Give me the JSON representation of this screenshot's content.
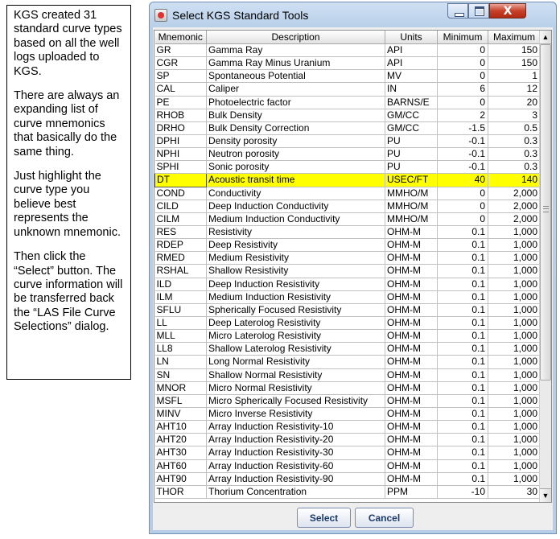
{
  "annotation": {
    "paragraphs": [
      "KGS created 31 standard curve types based on all the well logs uploaded to KGS.",
      "There are always an expanding list of curve mnemonics that basically do the same thing.",
      "Just highlight the curve type  you believe best represents the unknown mnemonic.",
      "Then click the “Select” button. The curve information will be transferred back the “LAS File Curve Selections” dialog."
    ]
  },
  "window": {
    "title": "Select KGS Standard Tools",
    "close_glyph": "X"
  },
  "table": {
    "columns": [
      "Mnemonic",
      "Description",
      "Units",
      "Minimum",
      "Maximum"
    ],
    "selected_row": 10,
    "rows": [
      [
        "GR",
        "Gamma Ray",
        "API",
        "0",
        "150"
      ],
      [
        "CGR",
        "Gamma Ray Minus Uranium",
        "API",
        "0",
        "150"
      ],
      [
        "SP",
        "Spontaneous Potential",
        "MV",
        "0",
        "1"
      ],
      [
        "CAL",
        "Caliper",
        "IN",
        "6",
        "12"
      ],
      [
        "PE",
        "Photoelectric factor",
        "BARNS/E",
        "0",
        "20"
      ],
      [
        "RHOB",
        "Bulk Density",
        "GM/CC",
        "2",
        "3"
      ],
      [
        "DRHO",
        "Bulk Density Correction",
        "GM/CC",
        "-1.5",
        "0.5"
      ],
      [
        "DPHI",
        "Density porosity",
        "PU",
        "-0.1",
        "0.3"
      ],
      [
        "NPHI",
        "Neutron porosity",
        "PU",
        "-0.1",
        "0.3"
      ],
      [
        "SPHI",
        "Sonic porosity",
        "PU",
        "-0.1",
        "0.3"
      ],
      [
        "DT",
        "Acoustic transit time",
        "USEC/FT",
        "40",
        "140"
      ],
      [
        "COND",
        "Conductivity",
        "MMHO/M",
        "0",
        "2,000"
      ],
      [
        "CILD",
        "Deep Induction Conductivity",
        "MMHO/M",
        "0",
        "2,000"
      ],
      [
        "CILM",
        "Medium Induction Conductivity",
        "MMHO/M",
        "0",
        "2,000"
      ],
      [
        "RES",
        "Resistivity",
        "OHM-M",
        "0.1",
        "1,000"
      ],
      [
        "RDEP",
        "Deep Resistivity",
        "OHM-M",
        "0.1",
        "1,000"
      ],
      [
        "RMED",
        "Medium Resistivity",
        "OHM-M",
        "0.1",
        "1,000"
      ],
      [
        "RSHAL",
        "Shallow Resistivity",
        "OHM-M",
        "0.1",
        "1,000"
      ],
      [
        "ILD",
        "Deep Induction Resistivity",
        "OHM-M",
        "0.1",
        "1,000"
      ],
      [
        "ILM",
        "Medium Induction Resistivity",
        "OHM-M",
        "0.1",
        "1,000"
      ],
      [
        "SFLU",
        "Spherically Focused Resistivity",
        "OHM-M",
        "0.1",
        "1,000"
      ],
      [
        "LL",
        "Deep Laterolog Resistivity",
        "OHM-M",
        "0.1",
        "1,000"
      ],
      [
        "MLL",
        "Micro Laterolog Resistivity",
        "OHM-M",
        "0.1",
        "1,000"
      ],
      [
        "LL8",
        "Shallow Laterolog Resistivity",
        "OHM-M",
        "0.1",
        "1,000"
      ],
      [
        "LN",
        "Long Normal Resistivity",
        "OHM-M",
        "0.1",
        "1,000"
      ],
      [
        "SN",
        "Shallow Normal Resistivity",
        "OHM-M",
        "0.1",
        "1,000"
      ],
      [
        "MNOR",
        "Micro Normal Resistivity",
        "OHM-M",
        "0.1",
        "1,000"
      ],
      [
        "MSFL",
        "Micro Spherically Focused Resistivity",
        "OHM-M",
        "0.1",
        "1,000"
      ],
      [
        "MINV",
        "Micro Inverse Resistivity",
        "OHM-M",
        "0.1",
        "1,000"
      ],
      [
        "AHT10",
        "Array Induction Resistivity-10",
        "OHM-M",
        "0.1",
        "1,000"
      ],
      [
        "AHT20",
        "Array Induction Resistivity-20",
        "OHM-M",
        "0.1",
        "1,000"
      ],
      [
        "AHT30",
        "Array Induction Resistivity-30",
        "OHM-M",
        "0.1",
        "1,000"
      ],
      [
        "AHT60",
        "Array Induction Resistivity-60",
        "OHM-M",
        "0.1",
        "1,000"
      ],
      [
        "AHT90",
        "Array Induction Resistivity-90",
        "OHM-M",
        "0.1",
        "1,000"
      ],
      [
        "THOR",
        "Thorium Concentration",
        "PPM",
        "-10",
        "30"
      ]
    ]
  },
  "scrollbar": {
    "up_glyph": "▲",
    "down_glyph": "▼"
  },
  "buttons": {
    "select_label": "Select",
    "cancel_label": "Cancel"
  },
  "colors": {
    "selection": "#ffff00",
    "window_frame": "#b9d0ea"
  }
}
